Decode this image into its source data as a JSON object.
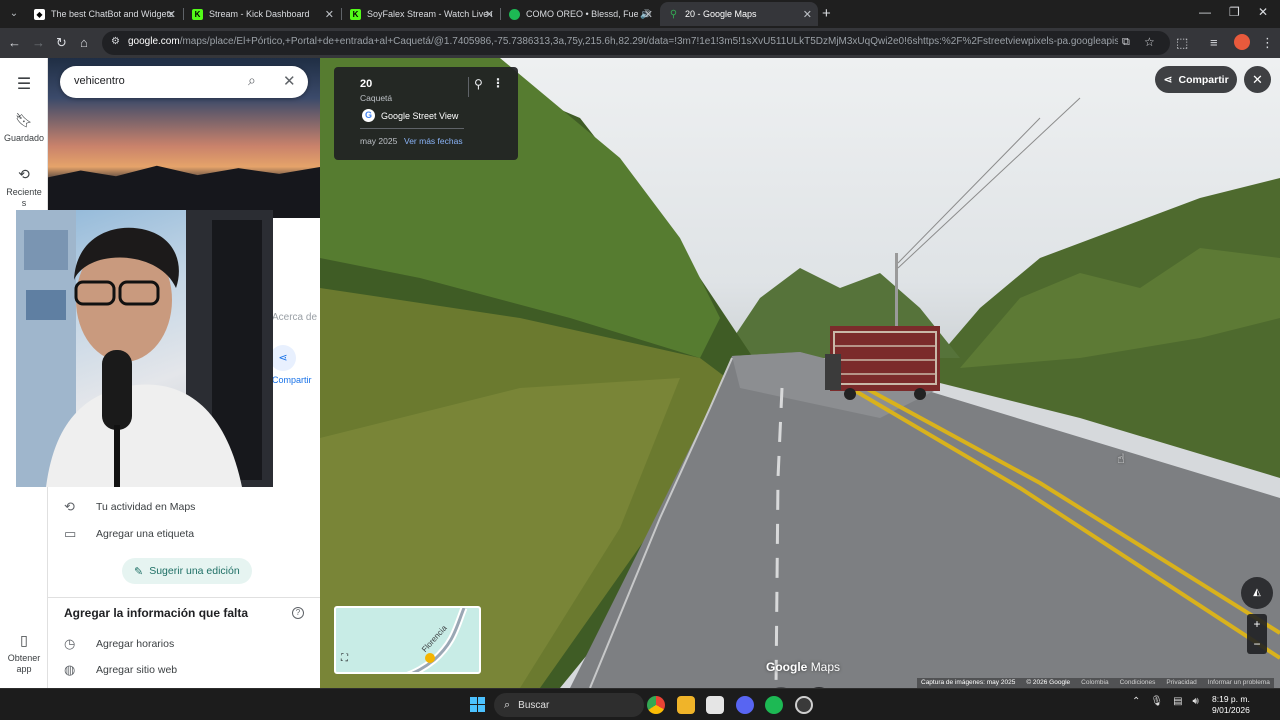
{
  "browser": {
    "tabs": [
      {
        "title": "The best ChatBot and Widgets",
        "favicon": "diamond-icon",
        "active": false
      },
      {
        "title": "Stream - Kick Dashboard",
        "favicon": "kick-icon",
        "active": false
      },
      {
        "title": "SoyFalex Stream - Watch Live o",
        "favicon": "kick-icon",
        "active": false
      },
      {
        "title": "COMO OREO • Blessd, Fue",
        "favicon": "spotify-icon",
        "active": false
      },
      {
        "title": "20 - Google Maps",
        "favicon": "maps-pin-icon",
        "active": true
      }
    ],
    "url_domain": "google.com",
    "url_rest": "/maps/place/El+Pórtico,+Portal+de+entrada+al+Caquetá/@1.7405986,-75.7386313,3a,75y,215.6h,82.29t/data=!3m7!1e1!3m5!1sXvU511ULkT5DzMjM3xUqQwi2e0!6shttps:%2F%2Fstreetviewpixels-pa.googleapis.com%2Fv1%2F..."
  },
  "rail": {
    "saved_label": "Guardado",
    "recent_label": "Reciente s",
    "get_app_label": "Obtener app"
  },
  "panel": {
    "search_value": "vehicentro",
    "about_tab": "Acerca de",
    "share_label": "Compartir",
    "activity_label": "Tu actividad en Maps",
    "add_label_label": "Agregar una etiqueta",
    "suggest_edit_label": "Sugerir una edición",
    "missing_info_title": "Agregar la información que falta",
    "add_hours_label": "Agregar horarios",
    "add_website_label": "Agregar sitio web"
  },
  "streetview": {
    "card_title": "20",
    "card_subtitle": "Caquetá",
    "card_source": "Google Street View",
    "card_date": "may 2025",
    "card_more_dates": "Ver más fechas",
    "share_label": "Compartir",
    "logo_google": "Google",
    "logo_maps": "Maps",
    "minimap_road_label": "Florencia",
    "attribution": [
      "Captura de imágenes: may 2025",
      "© 2026 Google",
      "Colombia",
      "Condiciones",
      "Privacidad",
      "Informar un problema"
    ]
  },
  "taskbar": {
    "search_placeholder": "Buscar",
    "time": "8:19 p. m.",
    "date": "9/01/2026"
  }
}
